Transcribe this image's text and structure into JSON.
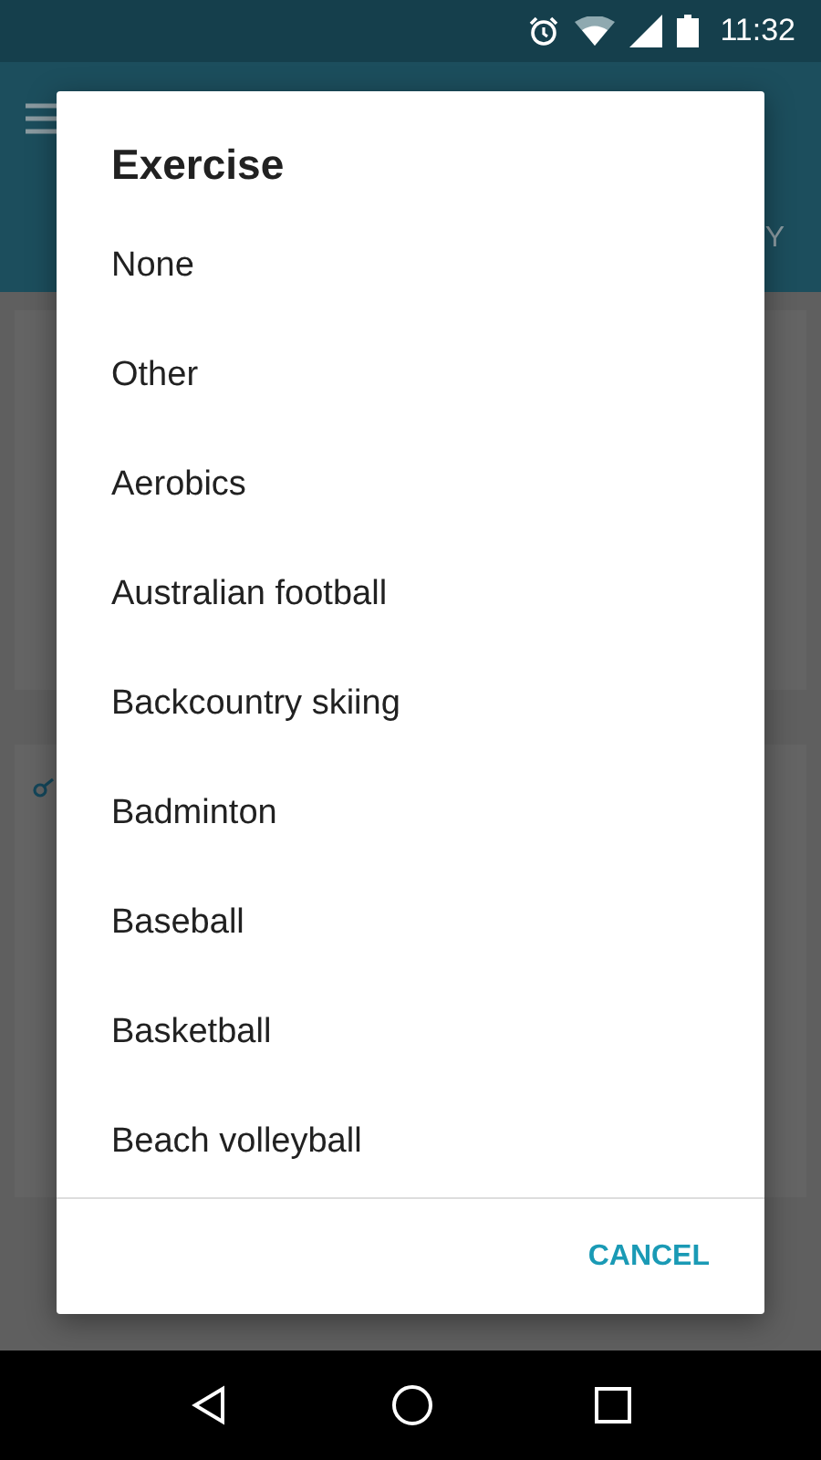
{
  "status_bar": {
    "time": "11:32"
  },
  "app_bar": {
    "tab_fragment": "Y"
  },
  "dialog": {
    "title": "Exercise",
    "items": [
      {
        "label": "None"
      },
      {
        "label": "Other"
      },
      {
        "label": "Aerobics"
      },
      {
        "label": "Australian football"
      },
      {
        "label": "Backcountry skiing"
      },
      {
        "label": "Badminton"
      },
      {
        "label": "Baseball"
      },
      {
        "label": "Basketball"
      },
      {
        "label": "Beach volleyball"
      }
    ],
    "buttons": [
      "CANCEL"
    ]
  }
}
